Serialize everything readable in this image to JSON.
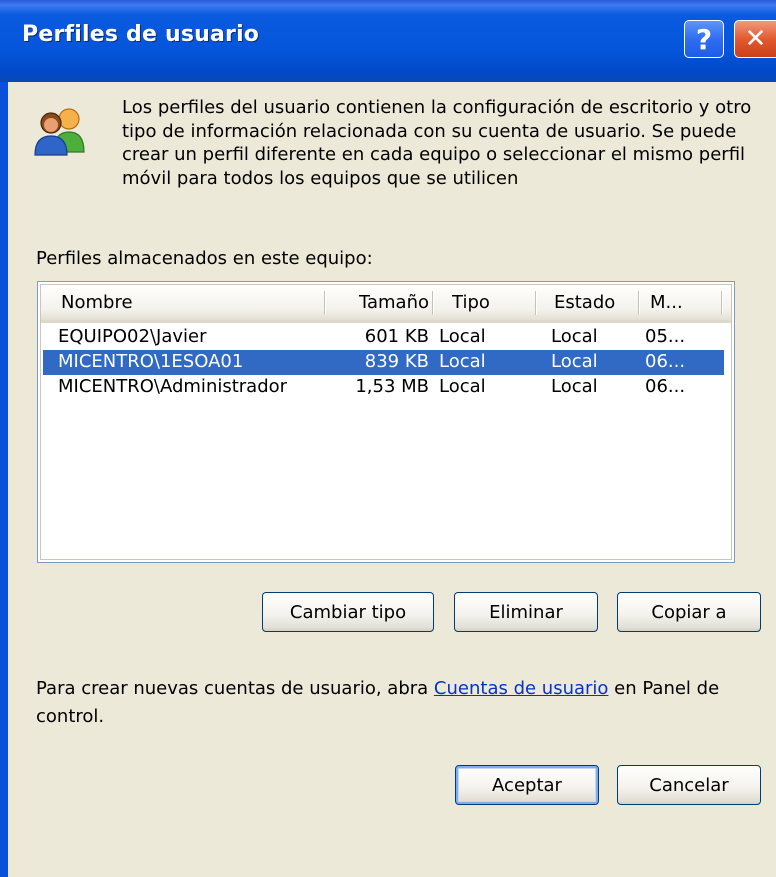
{
  "window": {
    "title": "Perfiles de usuario",
    "help_glyph": "?",
    "close_glyph": "✕"
  },
  "intro": {
    "icon": "users-icon",
    "text": "Los perfiles del usuario contienen la configuración de escritorio y otro tipo de información relacionada con su cuenta de usuario. Se puede crear un perfil diferente en cada equipo o seleccionar el mismo perfil móvil para todos los equipos que se utilicen"
  },
  "profiles": {
    "label": "Perfiles almacenados en este equipo:",
    "columns": [
      "Nombre",
      "Tamaño",
      "Tipo",
      "Estado",
      "M..."
    ],
    "rows": [
      {
        "name": "EQUIPO02\\Javier",
        "size": "601 KB",
        "type": "Local",
        "state": "Local",
        "modified": "05...",
        "selected": false
      },
      {
        "name": "MICENTRO\\1ESOA01",
        "size": "839 KB",
        "type": "Local",
        "state": "Local",
        "modified": "06...",
        "selected": true
      },
      {
        "name": "MICENTRO\\Administrador",
        "size": "1,53 MB",
        "type": "Local",
        "state": "Local",
        "modified": "06...",
        "selected": false
      }
    ]
  },
  "actions": {
    "change_type": "Cambiar tipo",
    "delete": "Eliminar",
    "copy_to": "Copiar a"
  },
  "footer": {
    "text_before": "Para crear nuevas cuentas de usuario, abra ",
    "link": "Cuentas de usuario",
    "text_after": " en Panel de control."
  },
  "dialog_buttons": {
    "ok": "Aceptar",
    "cancel": "Cancelar"
  },
  "colors": {
    "titlebar": "#0556db",
    "selection": "#316ac5",
    "dialog_bg": "#ece9d8",
    "link": "#0033cc"
  }
}
